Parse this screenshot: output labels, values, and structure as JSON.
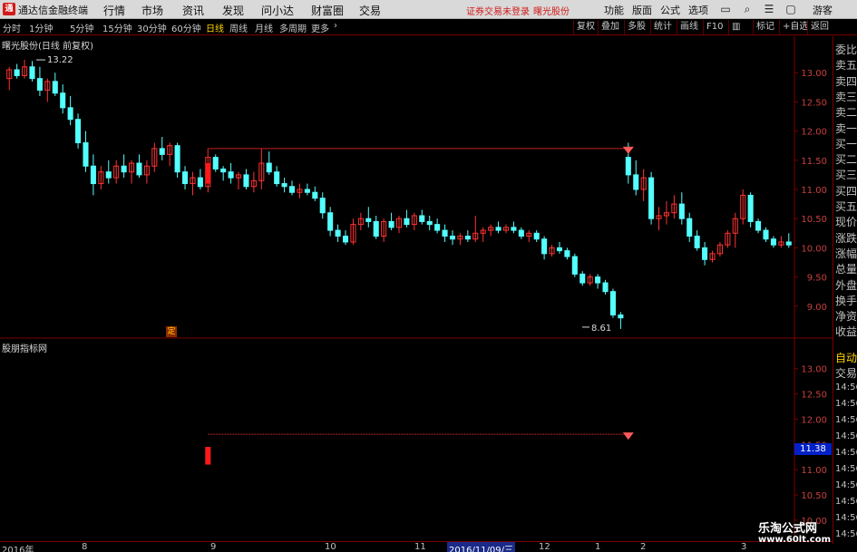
{
  "app": {
    "title": "通达信金融终端",
    "menu": [
      "行情",
      "市场",
      "资讯",
      "发现",
      "问小达",
      "财富圈",
      "交易"
    ],
    "warning": "证券交易未登录",
    "stock_name": "曙光股份",
    "right_menu": [
      "功能",
      "版面",
      "公式",
      "选项"
    ],
    "user": "游客",
    "logo_text": "通"
  },
  "toolbar": {
    "periods": [
      "分时",
      "1分钟",
      "5分钟",
      "15分钟",
      "30分钟",
      "60分钟",
      "日线",
      "周线",
      "月线",
      "多周期",
      "更多"
    ],
    "active_period": "日线",
    "tools": [
      "复权",
      "叠加",
      "多股",
      "统计",
      "画线",
      "F10",
      "标记",
      "+自选",
      "返回"
    ],
    "close_symbol": "✕"
  },
  "main_chart": {
    "title": "曙光股份(日线 前复权)",
    "high_label": "13.22",
    "low_label": "8.61",
    "mark_label": "定",
    "axis_ticks": [
      "13.00",
      "12.50",
      "12.00",
      "11.50",
      "11.00",
      "10.50",
      "10.00",
      "9.50",
      "9.00"
    ]
  },
  "indicator": {
    "title": "股朋指标网",
    "axis_ticks": [
      "13.00",
      "12.50",
      "12.00",
      "11.50",
      "11.00",
      "10.50",
      "10.00"
    ],
    "current_price": "11.38"
  },
  "side_panel": {
    "labels": [
      "委比",
      "卖五",
      "卖四",
      "卖三",
      "卖二",
      "卖一",
      "买一",
      "买二",
      "买三",
      "买四",
      "买五",
      "现价",
      "涨跌",
      "涨幅",
      "总量",
      "外盘",
      "换手",
      "净资",
      "收益"
    ],
    "auto_label": "自动",
    "trade_label": "交易",
    "times": [
      "14:56",
      "14:56",
      "14:56",
      "14:56",
      "14:56",
      "14:56",
      "14:56",
      "14:56",
      "14:56",
      "14:56"
    ]
  },
  "date_axis": {
    "labels": [
      "2016年",
      "8",
      "9",
      "10",
      "11",
      "12",
      "1",
      "2",
      "3"
    ],
    "cursor_date": "2016/11/09/三"
  },
  "watermark": {
    "name": "乐淘公式网",
    "url": "www.60lt.com"
  },
  "colors": {
    "up": "#ff3333",
    "down": "#54ffff",
    "signal": "#ff1a1a",
    "axis": "#7a0000",
    "active": "#ffd400"
  },
  "chart_data": {
    "type": "candlestick",
    "price_range": [
      8.5,
      13.5
    ],
    "ohlc": [
      [
        12.9,
        13.1,
        12.7,
        13.05
      ],
      [
        13.05,
        13.15,
        12.9,
        12.95
      ],
      [
        12.95,
        13.22,
        12.9,
        13.1
      ],
      [
        13.1,
        13.2,
        12.85,
        12.9
      ],
      [
        12.9,
        13.1,
        12.6,
        12.7
      ],
      [
        12.7,
        12.9,
        12.5,
        12.85
      ],
      [
        12.85,
        13.0,
        12.6,
        12.65
      ],
      [
        12.65,
        12.8,
        12.3,
        12.4
      ],
      [
        12.4,
        12.6,
        12.1,
        12.2
      ],
      [
        12.2,
        12.3,
        11.7,
        11.8
      ],
      [
        11.8,
        12.0,
        11.3,
        11.4
      ],
      [
        11.4,
        11.6,
        10.9,
        11.1
      ],
      [
        11.1,
        11.4,
        11.0,
        11.3
      ],
      [
        11.3,
        11.5,
        11.1,
        11.2
      ],
      [
        11.2,
        11.5,
        11.1,
        11.4
      ],
      [
        11.4,
        11.6,
        11.2,
        11.3
      ],
      [
        11.3,
        11.5,
        11.1,
        11.45
      ],
      [
        11.45,
        11.6,
        11.2,
        11.25
      ],
      [
        11.25,
        11.5,
        11.1,
        11.4
      ],
      [
        11.4,
        11.8,
        11.3,
        11.7
      ],
      [
        11.7,
        11.9,
        11.5,
        11.6
      ],
      [
        11.6,
        11.8,
        11.4,
        11.75
      ],
      [
        11.75,
        11.8,
        11.2,
        11.3
      ],
      [
        11.3,
        11.4,
        11.0,
        11.1
      ],
      [
        11.1,
        11.3,
        10.9,
        11.2
      ],
      [
        11.2,
        11.35,
        11.0,
        11.05
      ],
      [
        11.05,
        11.7,
        10.95,
        11.55
      ],
      [
        11.55,
        11.6,
        11.3,
        11.35
      ],
      [
        11.35,
        11.4,
        11.15,
        11.3
      ],
      [
        11.3,
        11.45,
        11.1,
        11.2
      ],
      [
        11.2,
        11.3,
        11.0,
        11.25
      ],
      [
        11.25,
        11.35,
        11.0,
        11.05
      ],
      [
        11.05,
        11.3,
        10.95,
        11.15
      ],
      [
        11.15,
        11.7,
        11.0,
        11.45
      ],
      [
        11.45,
        11.65,
        11.25,
        11.3
      ],
      [
        11.3,
        11.4,
        11.05,
        11.1
      ],
      [
        11.1,
        11.2,
        10.95,
        11.05
      ],
      [
        11.05,
        11.15,
        10.9,
        10.95
      ],
      [
        10.95,
        11.1,
        10.85,
        11.0
      ],
      [
        11.0,
        11.1,
        10.9,
        10.95
      ],
      [
        10.95,
        11.05,
        10.8,
        10.85
      ],
      [
        10.85,
        10.95,
        10.5,
        10.6
      ],
      [
        10.6,
        10.7,
        10.2,
        10.3
      ],
      [
        10.3,
        10.4,
        10.1,
        10.2
      ],
      [
        10.2,
        10.3,
        10.05,
        10.1
      ],
      [
        10.1,
        10.5,
        10.05,
        10.4
      ],
      [
        10.4,
        10.6,
        10.3,
        10.5
      ],
      [
        10.5,
        10.7,
        10.35,
        10.45
      ],
      [
        10.45,
        10.55,
        10.15,
        10.2
      ],
      [
        10.2,
        10.5,
        10.1,
        10.45
      ],
      [
        10.45,
        10.6,
        10.3,
        10.35
      ],
      [
        10.35,
        10.55,
        10.25,
        10.5
      ],
      [
        10.5,
        10.65,
        10.35,
        10.4
      ],
      [
        10.4,
        10.6,
        10.3,
        10.55
      ],
      [
        10.55,
        10.65,
        10.4,
        10.45
      ],
      [
        10.45,
        10.55,
        10.3,
        10.4
      ],
      [
        10.4,
        10.5,
        10.25,
        10.3
      ],
      [
        10.3,
        10.4,
        10.1,
        10.2
      ],
      [
        10.2,
        10.3,
        10.05,
        10.15
      ],
      [
        10.15,
        10.25,
        10.05,
        10.2
      ],
      [
        10.2,
        10.3,
        10.1,
        10.15
      ],
      [
        10.15,
        10.55,
        10.1,
        10.25
      ],
      [
        10.25,
        10.35,
        10.1,
        10.3
      ],
      [
        10.3,
        10.4,
        10.2,
        10.35
      ],
      [
        10.35,
        10.45,
        10.25,
        10.3
      ],
      [
        10.3,
        10.4,
        10.25,
        10.35
      ],
      [
        10.35,
        10.45,
        10.25,
        10.3
      ],
      [
        10.3,
        10.35,
        10.15,
        10.2
      ],
      [
        10.2,
        10.3,
        10.1,
        10.25
      ],
      [
        10.25,
        10.3,
        10.1,
        10.15
      ],
      [
        10.15,
        10.2,
        9.8,
        9.9
      ],
      [
        9.9,
        10.05,
        9.85,
        10.0
      ],
      [
        10.0,
        10.1,
        9.9,
        9.95
      ],
      [
        9.95,
        10.0,
        9.8,
        9.85
      ],
      [
        9.85,
        9.9,
        9.5,
        9.55
      ],
      [
        9.55,
        9.6,
        9.35,
        9.4
      ],
      [
        9.4,
        9.55,
        9.35,
        9.5
      ],
      [
        9.5,
        9.55,
        9.3,
        9.4
      ],
      [
        9.4,
        9.45,
        9.2,
        9.25
      ],
      [
        9.25,
        9.3,
        8.8,
        8.85
      ],
      [
        8.85,
        8.9,
        8.61,
        8.8
      ],
      [
        11.55,
        11.8,
        11.1,
        11.25
      ],
      [
        11.25,
        11.5,
        10.9,
        11.0
      ],
      [
        11.0,
        11.35,
        10.8,
        11.2
      ],
      [
        11.2,
        11.3,
        10.4,
        10.5
      ],
      [
        10.5,
        10.7,
        10.3,
        10.55
      ],
      [
        10.55,
        10.8,
        10.4,
        10.6
      ],
      [
        10.6,
        10.9,
        10.5,
        10.75
      ],
      [
        10.75,
        10.95,
        10.4,
        10.5
      ],
      [
        10.5,
        10.6,
        10.1,
        10.2
      ],
      [
        10.2,
        10.3,
        9.95,
        10.0
      ],
      [
        10.0,
        10.1,
        9.7,
        9.8
      ],
      [
        9.8,
        9.95,
        9.75,
        9.9
      ],
      [
        9.9,
        10.1,
        9.85,
        10.05
      ],
      [
        10.05,
        10.3,
        10.0,
        10.25
      ],
      [
        10.25,
        10.6,
        10.0,
        10.5
      ],
      [
        10.5,
        11.0,
        10.4,
        10.9
      ],
      [
        10.9,
        10.95,
        10.35,
        10.45
      ],
      [
        10.45,
        10.5,
        10.25,
        10.3
      ],
      [
        10.3,
        10.35,
        10.1,
        10.15
      ],
      [
        10.15,
        10.2,
        10.0,
        10.05
      ],
      [
        10.05,
        10.2,
        10.0,
        10.1
      ],
      [
        10.1,
        10.25,
        10.0,
        10.05
      ]
    ],
    "signal": {
      "resistance": 11.7,
      "start_index": 26,
      "end_index": 81
    }
  }
}
